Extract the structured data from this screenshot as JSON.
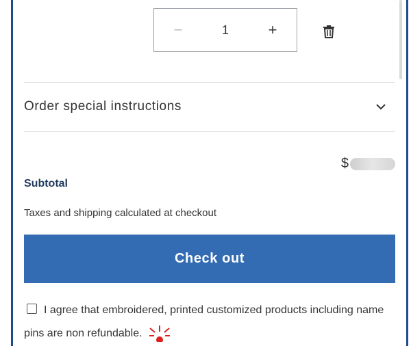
{
  "cart_item": {
    "decrease_icon": "minus-icon",
    "increase_icon": "plus-icon",
    "quantity": "1",
    "minus_symbol": "−",
    "plus_symbol": "+",
    "remove_icon": "trash-icon"
  },
  "order_instructions": {
    "label": "Order special instructions",
    "toggle_icon": "chevron-down-icon"
  },
  "summary": {
    "price_prefix": "$",
    "subtotal_label": "Subtotal",
    "tax_note": "Taxes and shipping calculated at checkout"
  },
  "checkout_button": {
    "label": "Check out",
    "color": "#336cb3"
  },
  "agreement": {
    "text": "I agree that embroidered, printed customized products including name pins are non refundable.",
    "checked": false,
    "attention_icon": "sparkle-icon",
    "attention_color": "#e0201c"
  },
  "colors": {
    "frame_border": "#1e4b8f",
    "subtotal_label": "#1e3a5c"
  }
}
